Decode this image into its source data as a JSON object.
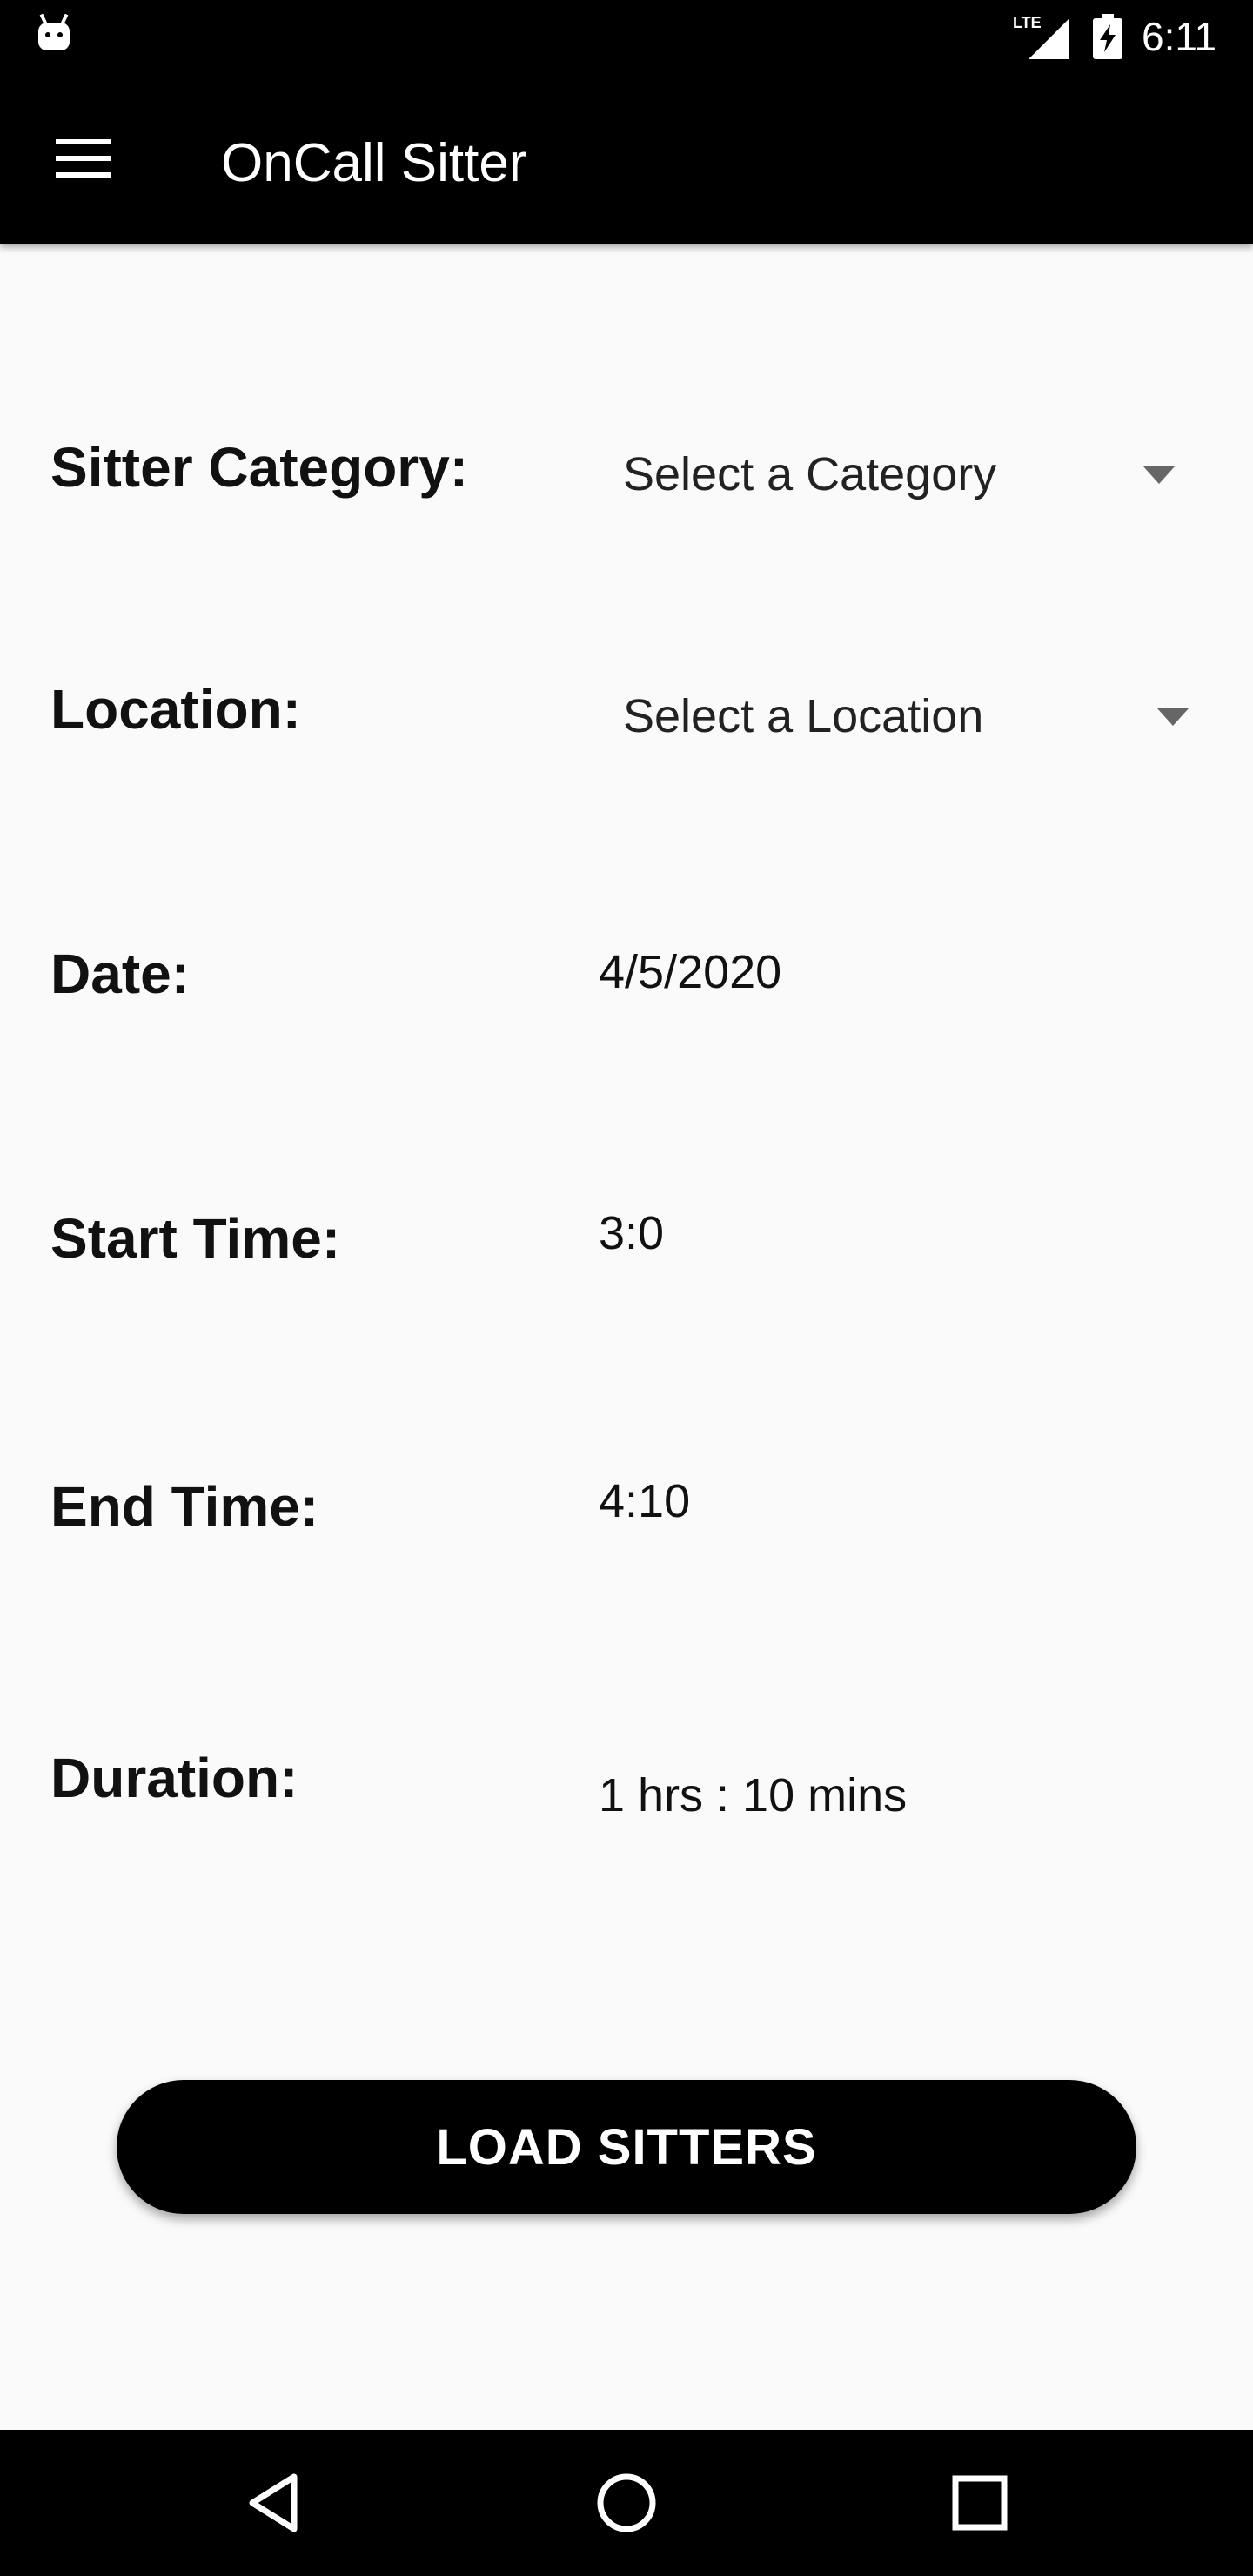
{
  "status_bar": {
    "network": "LTE",
    "time": "6:11"
  },
  "app_bar": {
    "title": "OnCall Sitter"
  },
  "form": {
    "category": {
      "label": "Sitter Category:",
      "placeholder": "Select a Category"
    },
    "location": {
      "label": "Location:",
      "placeholder": "Select a Location"
    },
    "date": {
      "label": "Date:",
      "value": "4/5/2020"
    },
    "start_time": {
      "label": "Start Time:",
      "value": "3:0"
    },
    "end_time": {
      "label": "End Time:",
      "value": "4:10"
    },
    "duration": {
      "label": "Duration:",
      "value": "1 hrs : 10 mins"
    }
  },
  "actions": {
    "load_label": "LOAD SITTERS"
  },
  "icons": {
    "menu": "hamburger-menu-icon",
    "dropdown": "triangle-down-icon",
    "nav_back": "triangle-left-icon",
    "nav_home": "circle-icon",
    "nav_recents": "square-icon"
  },
  "colors": {
    "bar": "#000000",
    "background": "#fafafa",
    "button": "#000000",
    "caret": "#666666"
  }
}
